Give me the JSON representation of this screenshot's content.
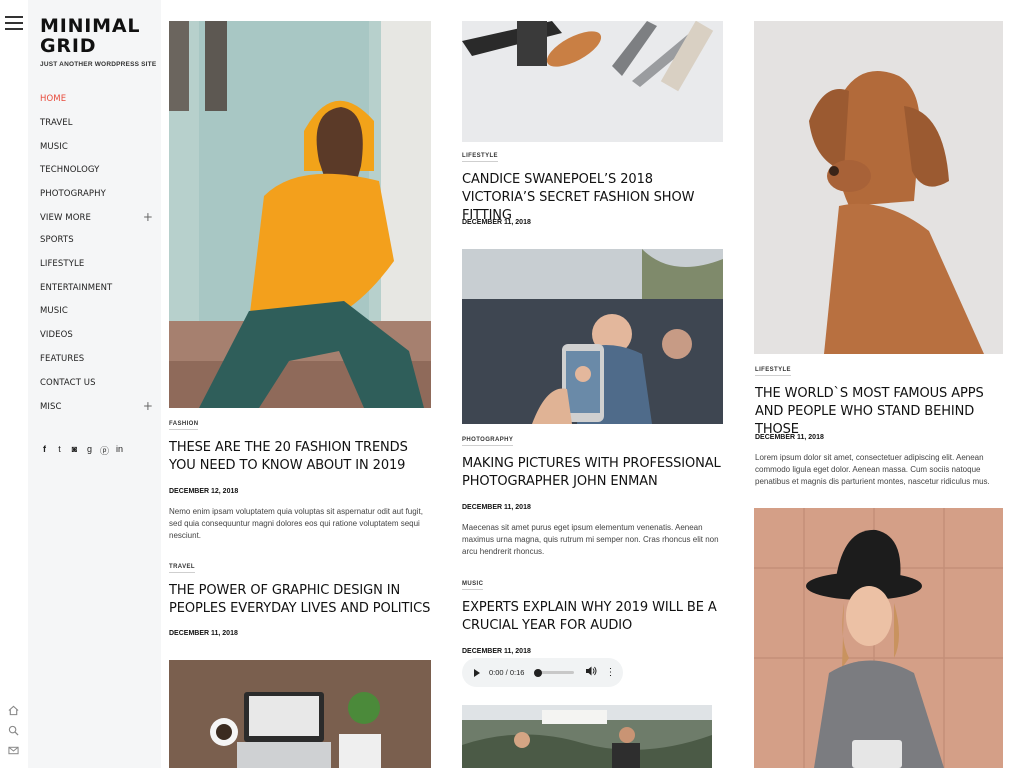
{
  "site": {
    "logo": "MINIMAL GRID",
    "tagline": "JUST ANOTHER WORDPRESS SITE"
  },
  "nav": [
    {
      "label": "HOME",
      "active": true
    },
    {
      "label": "TRAVEL"
    },
    {
      "label": "MUSIC"
    },
    {
      "label": "TECHNOLOGY"
    },
    {
      "label": "PHOTOGRAPHY"
    },
    {
      "label": "VIEW MORE",
      "expandable": true
    },
    {
      "label": "SPORTS"
    },
    {
      "label": "LIFESTYLE"
    },
    {
      "label": "ENTERTAINMENT"
    },
    {
      "label": "MUSIC"
    },
    {
      "label": "VIDEOS"
    },
    {
      "label": "FEATURES"
    },
    {
      "label": "CONTACT US"
    },
    {
      "label": "MISC",
      "expandable": true
    }
  ],
  "nav_plus": "+",
  "social_icons": [
    "facebook-icon",
    "twitter-icon",
    "instagram-icon",
    "google-plus-icon",
    "pinterest-icon",
    "linkedin-icon"
  ],
  "social_glyphs": [
    "f",
    "t",
    "◙",
    "g",
    "ⓟ",
    "in"
  ],
  "rail_icons": [
    "home-icon",
    "search-icon",
    "mail-icon"
  ],
  "accent_color": "#e84b3c",
  "posts": {
    "fashion": {
      "category": "FASHION",
      "title": "THESE ARE THE 20 FASHION TRENDS YOU NEED TO KNOW ABOUT IN 2019",
      "date": "DECEMBER 12, 2018",
      "excerpt": "Nemo enim ipsam voluptatem quia voluptas sit aspernatur odit aut fugit, sed quia consequuntur magni dolores eos qui ratione voluptatem sequi nesciunt."
    },
    "travel": {
      "category": "TRAVEL",
      "title": "THE POWER OF GRAPHIC DESIGN IN PEOPLES EVERYDAY LIVES AND POLITICS",
      "date": "DECEMBER 11, 2018"
    },
    "lifestyle1": {
      "category": "LIFESTYLE",
      "title": "CANDICE SWANEPOEL’S 2018 VICTORIA’S SECRET FASHION SHOW FITTING",
      "date": "DECEMBER 11, 2018"
    },
    "photography": {
      "category": "PHOTOGRAPHY",
      "title": "MAKING PICTURES WITH PROFESSIONAL PHOTOGRAPHER JOHN ENMAN",
      "date": "DECEMBER 11, 2018",
      "excerpt": "Maecenas sit amet purus eget ipsum elementum venenatis. Aenean maximus urna magna, quis rutrum mi semper non. Cras rhoncus elit non arcu hendrerit rhoncus."
    },
    "music": {
      "category": "MUSIC",
      "title": "EXPERTS EXPLAIN WHY 2019 WILL BE A CRUCIAL YEAR FOR AUDIO",
      "date": "DECEMBER 11, 2018",
      "audio_time": "0:00 / 0:16",
      "audio_progress": 0
    },
    "lifestyle2": {
      "category": "LIFESTYLE",
      "title": "THE WORLD`S MOST FAMOUS APPS AND PEOPLE WHO STAND BEHIND THOSE",
      "date": "DECEMBER 11, 2018",
      "excerpt": "Lorem ipsum dolor sit amet, consectetuer adipiscing elit. Aenean commodo ligula eget dolor. Aenean massa. Cum sociis natoque penatibus et magnis dis parturient montes, nascetur ridiculus mus."
    }
  }
}
